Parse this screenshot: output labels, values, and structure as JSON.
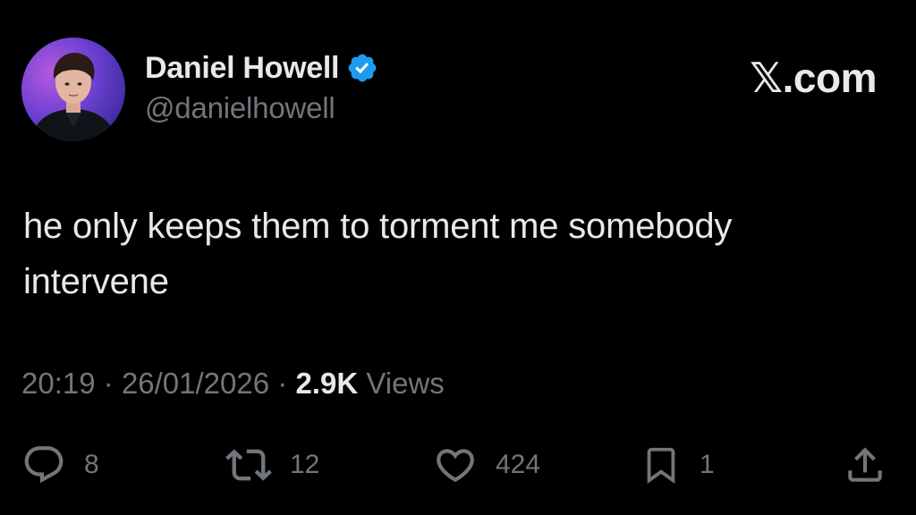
{
  "author": {
    "display_name": "Daniel Howell",
    "handle": "@danielhowell",
    "verified": true
  },
  "brand": {
    "logo_text": "𝕏.com"
  },
  "tweet": {
    "text": "he only keeps them to torment me somebody intervene",
    "time": "20:19",
    "separator": "·",
    "date": "26/01/2026",
    "views_count": "2.9K",
    "views_label": "Views"
  },
  "actions": {
    "replies": "8",
    "reposts": "12",
    "likes": "424",
    "bookmarks": "1"
  },
  "colors": {
    "background": "#000000",
    "primary_text": "#e7e9ea",
    "secondary_text": "#71767b",
    "verified_badge": "#1d9bf0"
  },
  "icons": {
    "reply": "reply-icon",
    "repost": "repost-icon",
    "like": "heart-icon",
    "bookmark": "bookmark-icon",
    "share": "share-icon",
    "verified": "verified-badge-icon"
  }
}
